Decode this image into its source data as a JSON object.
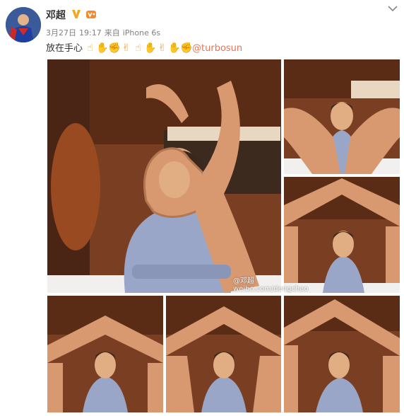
{
  "post": {
    "username": "邓超",
    "verified_icon": "verified-v-icon",
    "vip_icon": "vip-icon",
    "date": "3月27日",
    "time": "19:17",
    "source_prefix": "来自",
    "source_device": "iPhone 6s",
    "text": "放在手心",
    "emojis": [
      "finger-point-icon",
      "pray-icon",
      "handshake-icon",
      "peace-icon",
      "thumbs-up-icon",
      "ok-hand-icon",
      "rock-icon",
      "ok-hand-icon",
      "fist-icon"
    ],
    "mention": "@turbosun",
    "mention_color": "#eb7350"
  },
  "watermark": {
    "line1": "@邓超",
    "line2": "weibo.com/dengchao"
  },
  "photos": [
    {
      "name": "photo-ok-hand",
      "alt": "OK hand framing face"
    },
    {
      "name": "photo-open-palms",
      "alt": "open palms"
    },
    {
      "name": "photo-hand-roof-1",
      "alt": "hands roof"
    },
    {
      "name": "photo-hand-roof-2",
      "alt": "hands roof"
    },
    {
      "name": "photo-hand-roof-3",
      "alt": "hands roof"
    },
    {
      "name": "photo-hand-roof-4",
      "alt": "hands roof"
    }
  ]
}
